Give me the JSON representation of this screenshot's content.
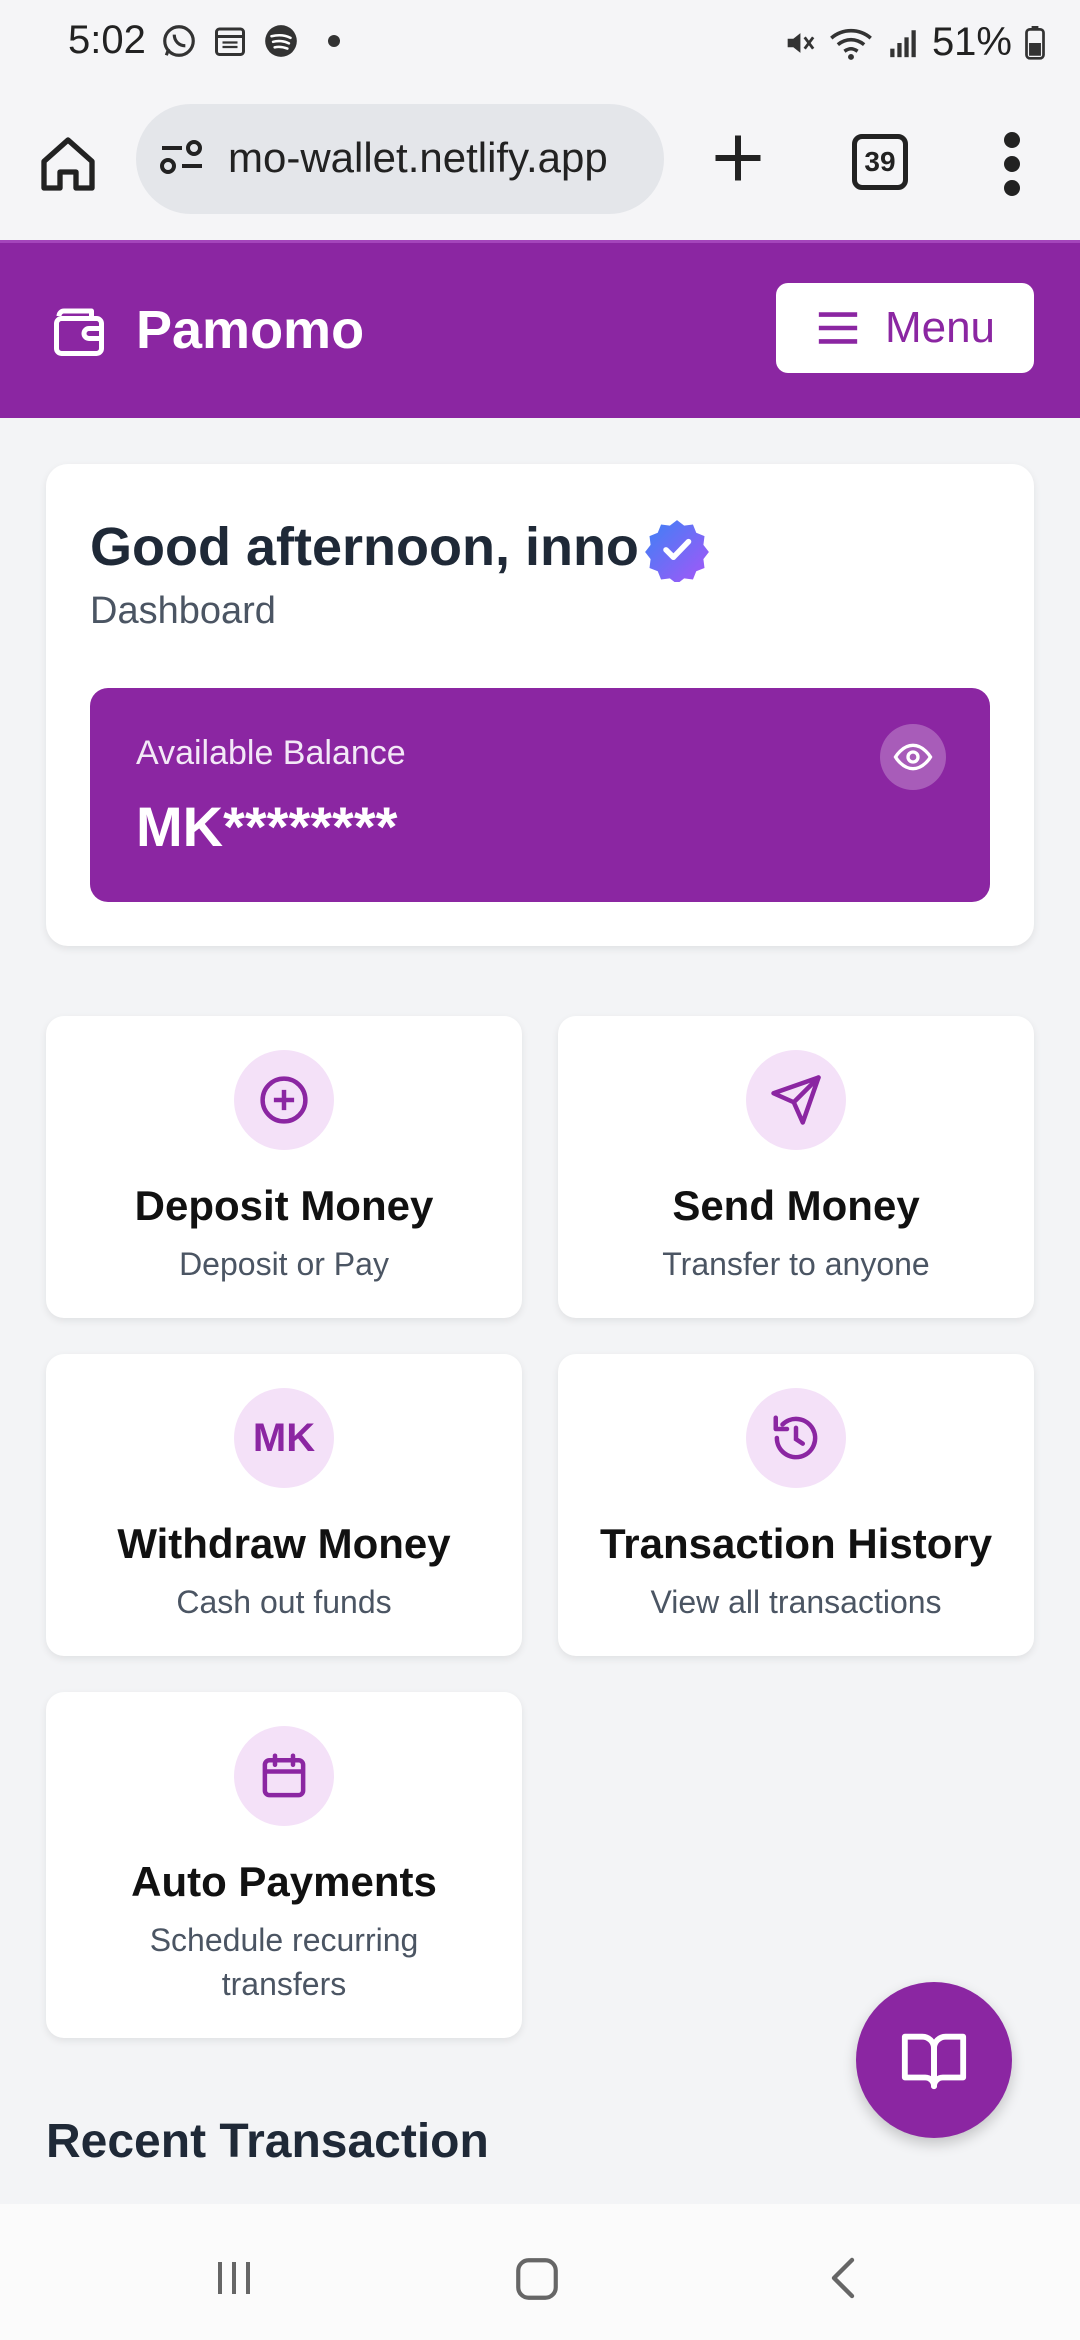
{
  "status_bar": {
    "time": "5:02",
    "battery": "51%",
    "icons": [
      "whatsapp-icon",
      "calendar-icon",
      "spotify-icon",
      "dot-icon",
      "mute-icon",
      "wifi-icon",
      "signal-icon",
      "battery-icon"
    ]
  },
  "browser": {
    "url": "mo-wallet.netlify.app",
    "tab_count": "39"
  },
  "app": {
    "name": "Pamomo",
    "menu_label": "Menu",
    "accent_color": "#8b26a2"
  },
  "dashboard": {
    "greeting": "Good afternoon, inno",
    "subtitle": "Dashboard",
    "balance_label": "Available Balance",
    "balance_value": "MK********"
  },
  "actions": [
    {
      "title": "Deposit Money",
      "subtitle": "Deposit or Pay",
      "icon": "plus-circle-icon"
    },
    {
      "title": "Send Money",
      "subtitle": "Transfer to anyone",
      "icon": "send-icon"
    },
    {
      "title": "Withdraw Money",
      "subtitle": "Cash out funds",
      "icon_text": "MK"
    },
    {
      "title": "Transaction History",
      "subtitle": "View all transactions",
      "icon": "history-icon"
    },
    {
      "title": "Auto Payments",
      "subtitle": "Schedule recurring transfers",
      "icon": "calendar-icon"
    }
  ],
  "recent": {
    "heading": "Recent Transaction"
  }
}
